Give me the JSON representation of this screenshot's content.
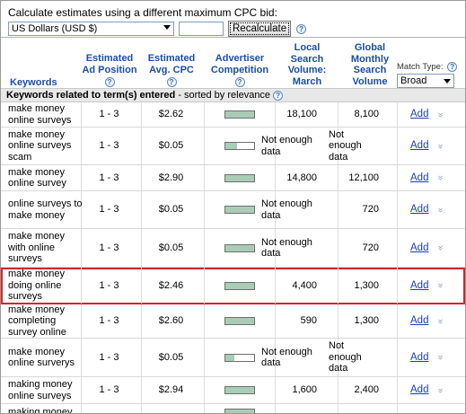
{
  "calc": {
    "title": "Calculate estimates using a different maximum CPC bid:",
    "currency": "US Dollars (USD $)",
    "bid_value": "",
    "recalc_label": "Recalculate"
  },
  "headers": {
    "keywords": "Keywords",
    "position": "Estimated\nAd Position",
    "cpc": "Estimated\nAvg. CPC",
    "competition": "Advertiser\nCompetition",
    "local": "Local\nSearch\nVolume:\nMarch",
    "global": "Global\nMonthly\nSearch\nVolume",
    "match_label": "Match Type:",
    "match_value": "Broad"
  },
  "section": {
    "title": "Keywords related to term(s) entered",
    "suffix": " - sorted by relevance"
  },
  "help_glyph": "?",
  "add_label": "Add",
  "rows": [
    {
      "keyword": "make money online surveys",
      "position": "1 - 3",
      "cpc": "$2.62",
      "competition": 1.0,
      "local": "18,100",
      "global": "8,100",
      "highlight": false
    },
    {
      "keyword": "make money online surveys scam",
      "position": "1 - 3",
      "cpc": "$0.05",
      "competition": 0.4,
      "local": "Not enough data",
      "global": "Not enough data",
      "highlight": false
    },
    {
      "keyword": "make money online survey",
      "position": "1 - 3",
      "cpc": "$2.90",
      "competition": 1.0,
      "local": "14,800",
      "global": "12,100",
      "highlight": false
    },
    {
      "keyword": "online surveys to make money",
      "position": "1 - 3",
      "cpc": "$0.05",
      "competition": 1.0,
      "local": "Not enough data",
      "global": "720",
      "highlight": false
    },
    {
      "keyword": "make money with online surveys",
      "position": "1 - 3",
      "cpc": "$0.05",
      "competition": 1.0,
      "local": "Not enough data",
      "global": "720",
      "highlight": false
    },
    {
      "keyword": "make money doing online surveys",
      "position": "1 - 3",
      "cpc": "$2.46",
      "competition": 1.0,
      "local": "4,400",
      "global": "1,300",
      "highlight": true
    },
    {
      "keyword": "make money completing survey online",
      "position": "1 - 3",
      "cpc": "$2.60",
      "competition": 1.0,
      "local": "590",
      "global": "1,300",
      "highlight": false
    },
    {
      "keyword": "make money online surverys",
      "position": "1 - 3",
      "cpc": "$0.05",
      "competition": 0.3,
      "local": "Not enough data",
      "global": "Not enough data",
      "highlight": false
    },
    {
      "keyword": "making money online surveys",
      "position": "1 - 3",
      "cpc": "$2.94",
      "competition": 1.0,
      "local": "1,600",
      "global": "2,400",
      "highlight": false
    },
    {
      "keyword": "making money",
      "position": "",
      "cpc": "",
      "competition": 1.0,
      "local": "",
      "global": "",
      "highlight": false
    }
  ]
}
